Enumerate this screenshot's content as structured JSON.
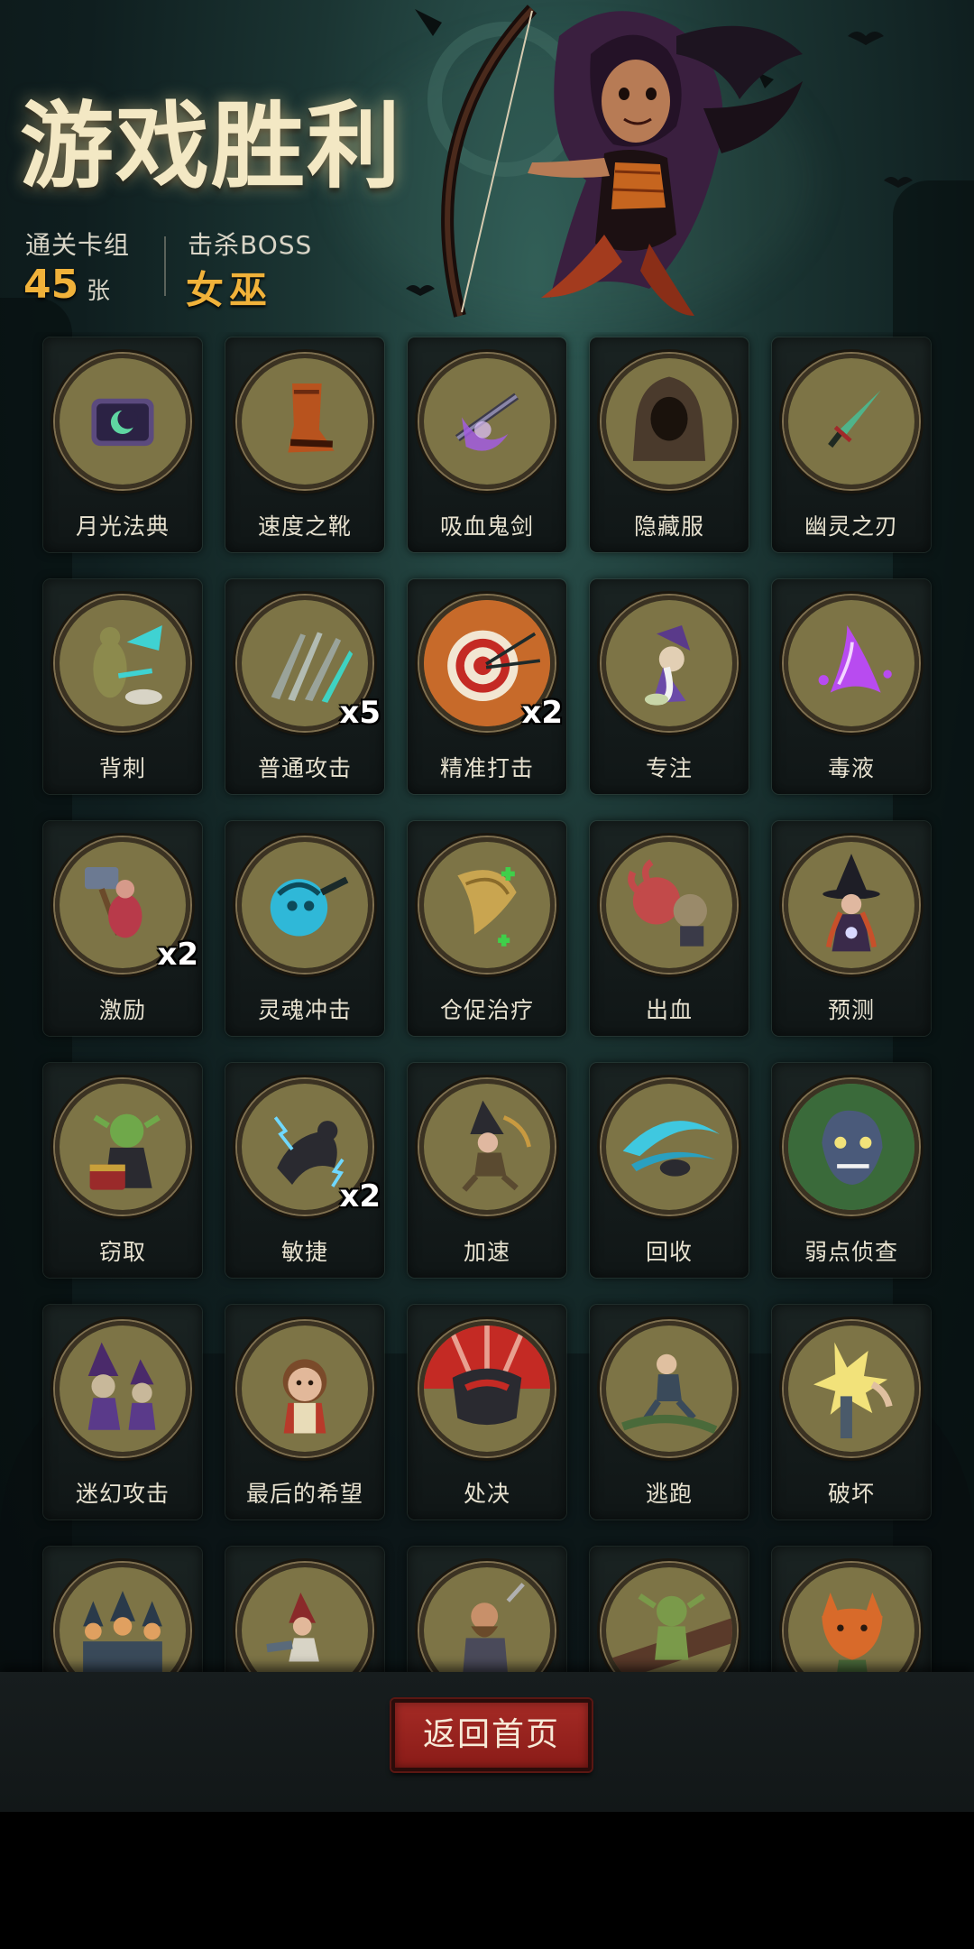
{
  "header": {
    "title": "游戏胜利",
    "deck_label": "通关卡组",
    "deck_count": "45",
    "deck_unit": "张",
    "boss_label": "击杀BOSS",
    "boss_name": "女巫"
  },
  "cards": [
    {
      "label": "月光法典",
      "icon": "moonlight-tome-icon",
      "mult": ""
    },
    {
      "label": "速度之靴",
      "icon": "speed-boots-icon",
      "mult": ""
    },
    {
      "label": "吸血鬼剑",
      "icon": "vampire-sword-icon",
      "mult": ""
    },
    {
      "label": "隐藏服",
      "icon": "hooded-cloak-icon",
      "mult": ""
    },
    {
      "label": "幽灵之刃",
      "icon": "ghost-blade-icon",
      "mult": ""
    },
    {
      "label": "背刺",
      "icon": "backstab-icon",
      "mult": ""
    },
    {
      "label": "普通攻击",
      "icon": "basic-attack-icon",
      "mult": "x5"
    },
    {
      "label": "精准打击",
      "icon": "precise-strike-icon",
      "mult": "x2"
    },
    {
      "label": "专注",
      "icon": "focus-icon",
      "mult": ""
    },
    {
      "label": "毒液",
      "icon": "venom-icon",
      "mult": ""
    },
    {
      "label": "激励",
      "icon": "inspire-icon",
      "mult": "x2"
    },
    {
      "label": "灵魂冲击",
      "icon": "soul-strike-icon",
      "mult": ""
    },
    {
      "label": "仓促治疗",
      "icon": "hasty-heal-icon",
      "mult": ""
    },
    {
      "label": "出血",
      "icon": "bleed-icon",
      "mult": ""
    },
    {
      "label": "预测",
      "icon": "foresight-icon",
      "mult": ""
    },
    {
      "label": "窃取",
      "icon": "steal-icon",
      "mult": ""
    },
    {
      "label": "敏捷",
      "icon": "agility-icon",
      "mult": "x2"
    },
    {
      "label": "加速",
      "icon": "haste-icon",
      "mult": ""
    },
    {
      "label": "回收",
      "icon": "recycle-icon",
      "mult": ""
    },
    {
      "label": "弱点侦查",
      "icon": "weakness-scout-icon",
      "mult": ""
    },
    {
      "label": "迷幻攻击",
      "icon": "illusion-attack-icon",
      "mult": ""
    },
    {
      "label": "最后的希望",
      "icon": "last-hope-icon",
      "mult": ""
    },
    {
      "label": "处决",
      "icon": "execute-icon",
      "mult": ""
    },
    {
      "label": "逃跑",
      "icon": "flee-icon",
      "mult": ""
    },
    {
      "label": "破坏",
      "icon": "destroy-icon",
      "mult": ""
    },
    {
      "label": "",
      "icon": "hooded-group-icon",
      "mult": ""
    },
    {
      "label": "",
      "icon": "red-hood-dash-icon",
      "mult": ""
    },
    {
      "label": "",
      "icon": "warrior-icon",
      "mult": ""
    },
    {
      "label": "",
      "icon": "goblin-icon",
      "mult": ""
    },
    {
      "label": "",
      "icon": "fox-icon",
      "mult": ""
    }
  ],
  "footer": {
    "home_button": "返回首页"
  },
  "colors": {
    "title": "#f3e8c4",
    "accent_gold": "#f0b23a",
    "button_red": "#a42a25",
    "coin_face": "#7d7446"
  }
}
